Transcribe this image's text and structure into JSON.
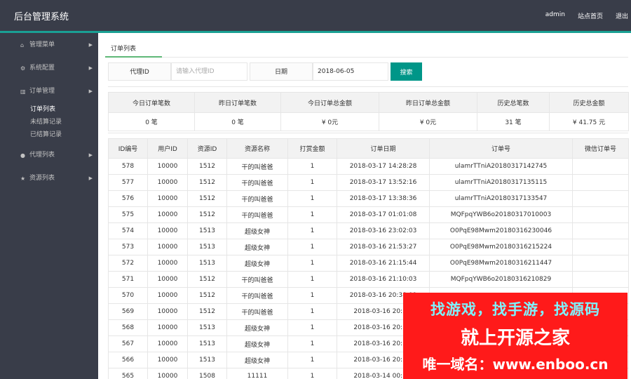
{
  "header": {
    "title": "后台管理系统",
    "nav": [
      "admin",
      "站点首页",
      "退出"
    ]
  },
  "sidebar": {
    "menus": [
      {
        "icon": "home-icon",
        "glyph": "⌂",
        "label": "管理菜单"
      },
      {
        "icon": "gears-icon",
        "glyph": "⚙",
        "label": "系统配置"
      },
      {
        "icon": "bar-chart-icon",
        "glyph": "▥",
        "label": "订单管理"
      },
      {
        "icon": "user-icon",
        "glyph": "●",
        "label": "代理列表"
      },
      {
        "icon": "star-icon",
        "glyph": "★",
        "label": "资源列表"
      }
    ],
    "order_submenu": [
      "订单列表",
      "未结算记录",
      "已结算记录"
    ]
  },
  "tab": {
    "label": "订单列表"
  },
  "search": {
    "agent_label": "代理ID",
    "agent_placeholder": "请输入代理ID",
    "agent_value": "",
    "date_label": "日期",
    "date_value": "2018-06-05",
    "button_label": "搜索"
  },
  "summary": {
    "headers": [
      "今日订单笔数",
      "昨日订单笔数",
      "今日订单总金额",
      "昨日订单总金额",
      "历史总笔数",
      "历史总金额"
    ],
    "values": [
      "0 笔",
      "0 笔",
      "¥ 0元",
      "¥ 0元",
      "31 笔",
      "¥ 41.75 元"
    ]
  },
  "orders": {
    "headers": [
      "ID编号",
      "用户ID",
      "资源ID",
      "资源名称",
      "打赏金额",
      "订单日期",
      "订单号",
      "微信订单号"
    ],
    "rows": [
      [
        "578",
        "10000",
        "1512",
        "干的叫爸爸",
        "1",
        "2018-03-17 14:28:28",
        "ulamrTTniA20180317142745",
        ""
      ],
      [
        "577",
        "10000",
        "1512",
        "干的叫爸爸",
        "1",
        "2018-03-17 13:52:16",
        "ulamrTTniA20180317135115",
        ""
      ],
      [
        "576",
        "10000",
        "1512",
        "干的叫爸爸",
        "1",
        "2018-03-17 13:38:36",
        "ulamrTTniA20180317133547",
        ""
      ],
      [
        "575",
        "10000",
        "1512",
        "干的叫爸爸",
        "1",
        "2018-03-17 01:01:08",
        "MQFpqYWB6o20180317010003",
        ""
      ],
      [
        "574",
        "10000",
        "1513",
        "超级女神",
        "1",
        "2018-03-16 23:02:03",
        "O0PqE98Mwm20180316230046",
        ""
      ],
      [
        "573",
        "10000",
        "1513",
        "超级女神",
        "1",
        "2018-03-16 21:53:27",
        "O0PqE98Mwm20180316215224",
        ""
      ],
      [
        "572",
        "10000",
        "1513",
        "超级女神",
        "1",
        "2018-03-16 21:15:44",
        "O0PqE98Mwm20180316211447",
        ""
      ],
      [
        "571",
        "10000",
        "1512",
        "干的叫爸爸",
        "1",
        "2018-03-16 21:10:03",
        "MQFpqYWB6o20180316210829",
        ""
      ],
      [
        "570",
        "10000",
        "1512",
        "干的叫爸爸",
        "1",
        "2018-03-16 20:38:09",
        "",
        ""
      ],
      [
        "569",
        "10000",
        "1512",
        "干的叫爸爸",
        "1",
        "2018-03-16 20:34:",
        "",
        ""
      ],
      [
        "568",
        "10000",
        "1513",
        "超级女神",
        "1",
        "2018-03-16 20:33:",
        "",
        ""
      ],
      [
        "567",
        "10000",
        "1513",
        "超级女神",
        "1",
        "2018-03-16 20:31:",
        "",
        ""
      ],
      [
        "566",
        "10000",
        "1513",
        "超级女神",
        "1",
        "2018-03-16 20:30:",
        "",
        ""
      ],
      [
        "565",
        "10000",
        "1508",
        "11111",
        "1",
        "2018-03-14 00:52:",
        "",
        ""
      ]
    ]
  },
  "watermark": {
    "line1": "找游戏，找手游，找源码",
    "line2": "就上开源之家",
    "line3": "唯一域名：www.enboo.cn"
  }
}
